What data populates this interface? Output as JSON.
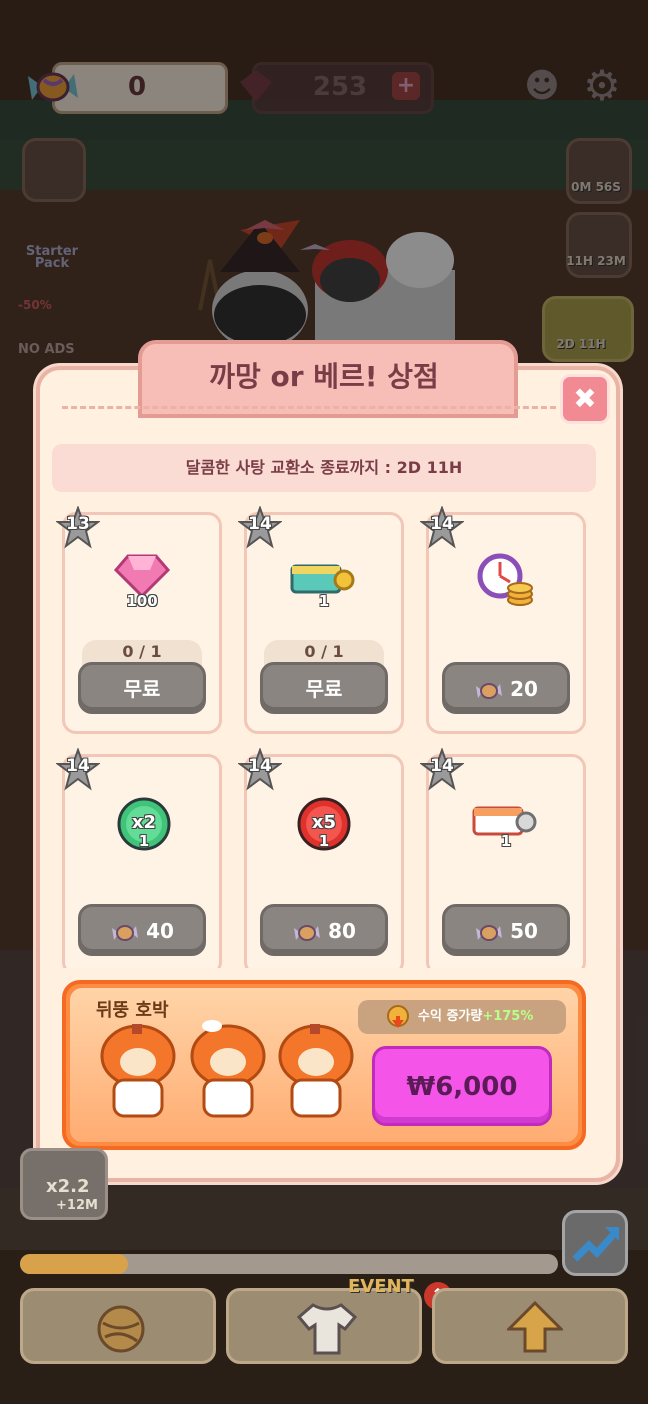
{
  "hud": {
    "candy_count": "0",
    "gem_count": "253",
    "gem_plus": "+"
  },
  "side_buttons": {
    "starter_pack_label": "Starter Pack",
    "no_ads_badge": "-50%",
    "no_ads_label": "NO ADS",
    "timer_1": "0M 56S",
    "timer_2": "11H 23M",
    "timer_3": "2D 11H"
  },
  "shop": {
    "title": "까망 or 베르! 상점",
    "close_icon": "✖",
    "banner": "달콤한 사탕 교환소 종료까지 : 2D 11H",
    "items": [
      {
        "level": "13",
        "icon": "gem-icon",
        "qty": "100",
        "limit": "0 / 1",
        "price": "무료",
        "currency": ""
      },
      {
        "level": "14",
        "icon": "ticket-key-icon",
        "qty": "1",
        "limit": "0 / 1",
        "price": "무료",
        "currency": ""
      },
      {
        "level": "14",
        "icon": "clock-coins-icon",
        "qty": "",
        "limit": "",
        "price": "20",
        "currency": "candy"
      },
      {
        "level": "14",
        "icon": "x2-boost-icon",
        "qty": "1",
        "limit": "",
        "price": "40",
        "currency": "candy"
      },
      {
        "level": "14",
        "icon": "x5-boost-icon",
        "qty": "1",
        "limit": "",
        "price": "80",
        "currency": "candy"
      },
      {
        "level": "14",
        "icon": "ticket-key-icon",
        "qty": "1",
        "limit": "",
        "price": "50",
        "currency": "candy"
      }
    ],
    "x2_label": "x2",
    "x5_label": "x5"
  },
  "promo": {
    "title": "뒤뚱 호박",
    "bonus_label": "수익 증가량",
    "bonus_value": "+175%",
    "price": "₩6,000"
  },
  "bottom": {
    "event_label": "EVENT",
    "progress_fraction": 0.2,
    "boost_multiplier": "x2.2",
    "boost_time": "+12M"
  },
  "colors": {
    "modal_bg": "#fff0e0",
    "tab_pink": "#f7bdb7",
    "buy_button_gray": "#8a8580",
    "promo_orange": "#fb8c42",
    "price_magenta": "#f454e8"
  }
}
